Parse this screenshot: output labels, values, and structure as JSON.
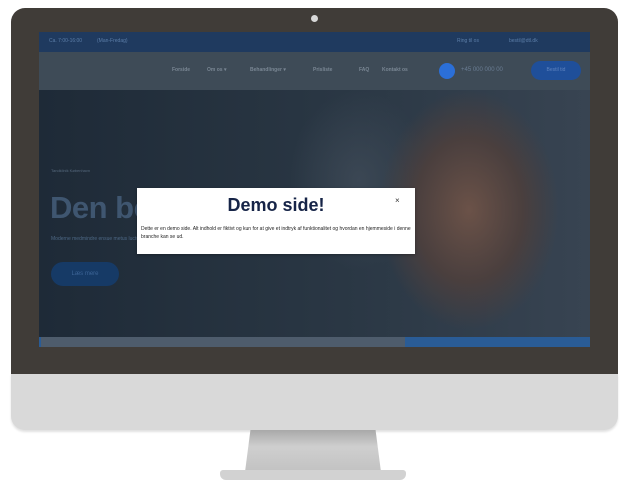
{
  "topbar": {
    "left_items": [
      "Ca. 7:00-16:00",
      "(Man-Fredag)"
    ],
    "right_items": [
      "Ring til os",
      "bestil@dtl.dk",
      "..."
    ]
  },
  "navbar": {
    "items": [
      "Forside",
      "Om os ▾",
      "Behandlinger ▾",
      "Prisliste",
      "FAQ",
      "Kontakt os"
    ],
    "phone": "+45 000 000 00",
    "book_button": "Bestil tid"
  },
  "hero": {
    "small_label": "Tandklinik København",
    "title": "Den bedste tandlæge",
    "subtitle": "Moderne medmindre ensue metus luctus in ullamcorper",
    "button": "Læs mere"
  },
  "modal": {
    "title": "Demo side!",
    "close": "×",
    "body": "Dette er en demo side. Alt indhold er fiktivt og kun for at give et indtryk af funktionalitet og hvordan en hjemmeside i denne branche kan se ud."
  }
}
